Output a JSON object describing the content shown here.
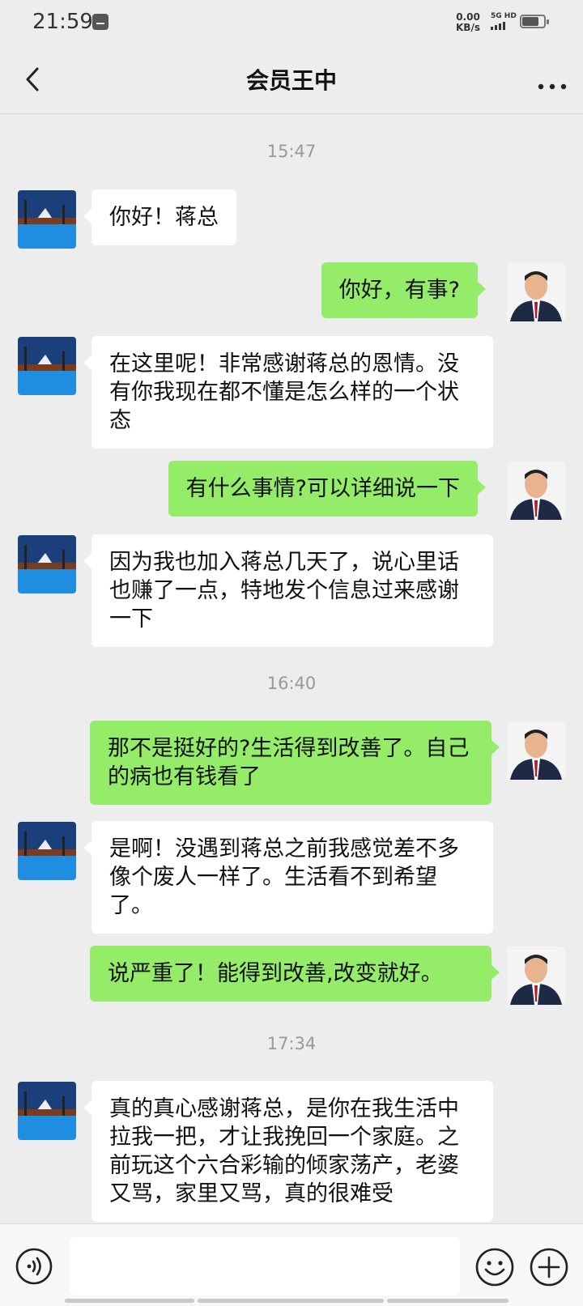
{
  "status_bar": {
    "time": "21:59",
    "net_speed_value": "0.00",
    "net_speed_unit": "KB/s",
    "network_label": "5G HD"
  },
  "nav": {
    "title": "会员王中",
    "back_icon": "chevron-left-icon",
    "more_icon": "more-dots-icon"
  },
  "timestamps": [
    "15:47",
    "16:40",
    "17:34"
  ],
  "messages": [
    {
      "side": "left",
      "text": "你好！蒋总"
    },
    {
      "side": "right",
      "text": "你好，有事?"
    },
    {
      "side": "left",
      "text": "在这里呢！非常感谢蒋总的恩情。没有你我现在都不懂是怎么样的一个状态"
    },
    {
      "side": "right",
      "text": "有什么事情?可以详细说一下"
    },
    {
      "side": "left",
      "text": "因为我也加入蒋总几天了，说心里话也赚了一点，特地发个信息过来感谢一下"
    },
    {
      "side": "right",
      "text": "那不是挺好的?生活得到改善了。自己的病也有钱看了"
    },
    {
      "side": "left",
      "text": "是啊！没遇到蒋总之前我感觉差不多像个废人一样了。生活看不到希望了。"
    },
    {
      "side": "right",
      "text": "说严重了！能得到改善,改变就好。"
    },
    {
      "side": "left",
      "text": "真的真心感谢蒋总，是你在我生活中拉我一把，才让我挽回一个家庭。之前玩这个六合彩输的倾家荡产，老婆又骂，家里又骂，真的很难受"
    }
  ],
  "input_bar": {
    "voice_icon": "voice-icon",
    "input_value": "",
    "emoji_icon": "emoji-icon",
    "plus_icon": "plus-icon"
  },
  "colors": {
    "background": "#ededed",
    "bubble_self": "#95ec69",
    "bubble_other": "#ffffff"
  }
}
